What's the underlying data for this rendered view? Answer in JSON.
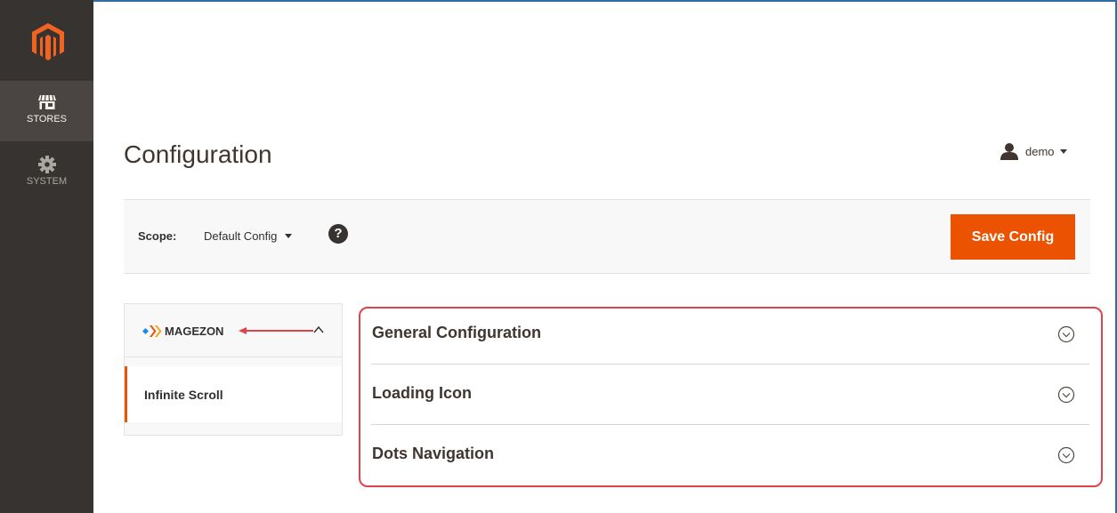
{
  "sidebar": {
    "logo": "magento-logo-icon",
    "items": [
      {
        "label": "STORES",
        "icon": "storefront-icon",
        "active": true
      },
      {
        "label": "SYSTEM",
        "icon": "gear-icon",
        "active": false
      }
    ]
  },
  "header": {
    "title": "Configuration",
    "user": {
      "name": "demo",
      "icon": "user-icon"
    }
  },
  "scope": {
    "label": "Scope:",
    "value": "Default Config",
    "help_icon": "question-icon",
    "help_glyph": "?"
  },
  "actions": {
    "save_label": "Save Config"
  },
  "tabs": {
    "group_label": "MAGEZON",
    "group_icon": "magezon-logo-icon",
    "items": [
      {
        "label": "Infinite Scroll",
        "active": true
      }
    ]
  },
  "sections": [
    {
      "title": "General Configuration"
    },
    {
      "title": "Loading Icon"
    },
    {
      "title": "Dots Navigation"
    }
  ],
  "colors": {
    "sidebar_bg": "#373330",
    "accent": "#eb5202",
    "highlight": "#e0424b"
  }
}
